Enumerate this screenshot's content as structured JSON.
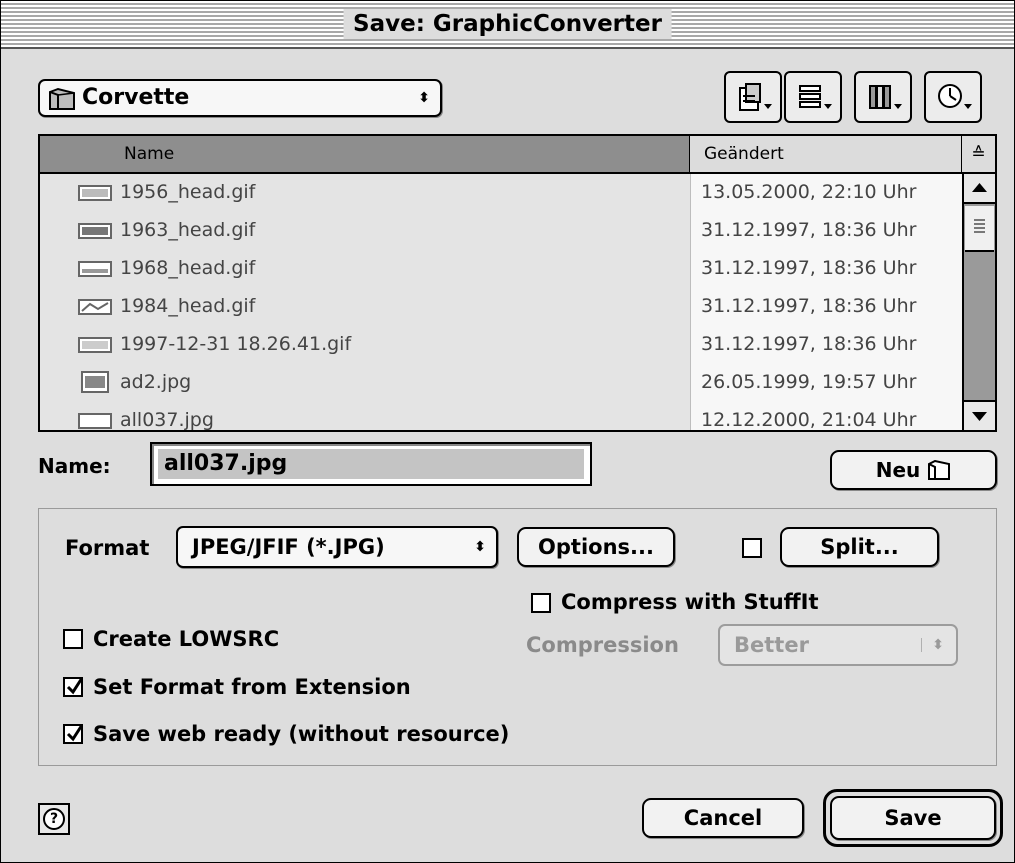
{
  "window": {
    "title": "Save: GraphicConverter"
  },
  "folder_popup": {
    "label": "Corvette",
    "icon": "folder-icon"
  },
  "toolbar": {
    "buttons": [
      {
        "icon": "desktop-shortcut-icon"
      },
      {
        "icon": "recent-folders-icon"
      },
      {
        "icon": "favorites-icon"
      },
      {
        "icon": "recent-items-icon"
      }
    ]
  },
  "file_list": {
    "columns": {
      "name": "Name",
      "modified": "Geändert",
      "sort_indicator": "≙"
    },
    "rows": [
      {
        "name": "1956_head.gif",
        "modified": "13.05.2000, 22:10 Uhr"
      },
      {
        "name": "1963_head.gif",
        "modified": "31.12.1997, 18:36 Uhr"
      },
      {
        "name": "1968_head.gif",
        "modified": "31.12.1997, 18:36 Uhr"
      },
      {
        "name": "1984_head.gif",
        "modified": "31.12.1997, 18:36 Uhr"
      },
      {
        "name": "1997-12-31 18.26.41.gif",
        "modified": "31.12.1997, 18:36 Uhr"
      },
      {
        "name": "ad2.jpg",
        "modified": "26.05.1999, 19:57 Uhr"
      },
      {
        "name": "all037.jpg",
        "modified": "12.12.2000, 21:04 Uhr"
      }
    ]
  },
  "name_field": {
    "label": "Name:",
    "value": "all037.jpg"
  },
  "new_folder_button": {
    "label": "Neu"
  },
  "format": {
    "label": "Format",
    "selected": "JPEG/JFIF (*.JPG)"
  },
  "options_button": {
    "label": "Options..."
  },
  "split": {
    "label": "Split...",
    "checked": false
  },
  "compress_stuffit": {
    "label": "Compress with StuffIt",
    "checked": false
  },
  "compression": {
    "label": "Compression",
    "selected": "Better",
    "enabled": false
  },
  "create_lowsrc": {
    "label": "Create LOWSRC",
    "checked": false
  },
  "set_format_from_extension": {
    "label": "Set Format from Extension",
    "checked": true
  },
  "save_web_ready": {
    "label": "Save web ready (without resource)",
    "checked": true
  },
  "help_button": {
    "label": "?"
  },
  "cancel_button": {
    "label": "Cancel"
  },
  "save_button": {
    "label": "Save"
  }
}
